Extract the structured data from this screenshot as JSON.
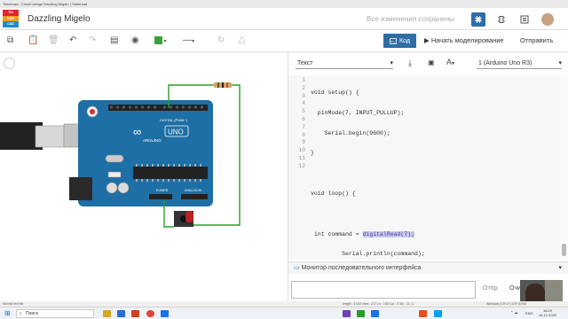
{
  "window": {
    "title": "Tinkercad - Circuit design Dazzling Migelo | Tinkercad"
  },
  "app": {
    "logo_letters": [
      "TIN",
      "KER",
      "CAD"
    ],
    "design_title": "Dazzling Migelo",
    "save_status": "Все изменения сохранены"
  },
  "toolbar": {
    "code_label": "Код",
    "simulate_label": "Начать моделирование",
    "send_label": "Отправить"
  },
  "code_editor": {
    "mode_select": "Текст",
    "device_select": "1 (Arduino Uno R3)",
    "line_numbers": [
      "1",
      "2",
      "3",
      "4",
      "5",
      "6",
      "7",
      "8",
      "9",
      "10",
      "11",
      "12"
    ],
    "lines": [
      "void setup() {",
      "  pinMode(7, INPUT_PULLUP);",
      "    Serial.begin(9600);",
      "}",
      "",
      "void loop() {",
      "",
      " int command = ",
      "         Serial.println(command);",
      "",
      "",
      "}"
    ],
    "highlight_text": "digitalRead(7);"
  },
  "serial_monitor": {
    "title": "Монитор последовательного интерфейса",
    "send_label": "Отпр.",
    "clear_label": "Очи"
  },
  "statusbar": {
    "left": "Normal text file",
    "middle": "length : 4 022    lines : 217          Ln : 153    Col : 3    Sel : 21 | 1",
    "right": "Windows (CR LF)     UTF-8     INS"
  },
  "taskbar": {
    "search_placeholder": "Поиск",
    "time": "16:29",
    "date": "14.12.2022",
    "language": "ENG"
  },
  "board": {
    "brand": "ARDUINO",
    "model": "UNO",
    "digital_label": "DIGITAL (PWM~)",
    "power_label": "POWER",
    "analog_label": "ANALOG IN"
  }
}
